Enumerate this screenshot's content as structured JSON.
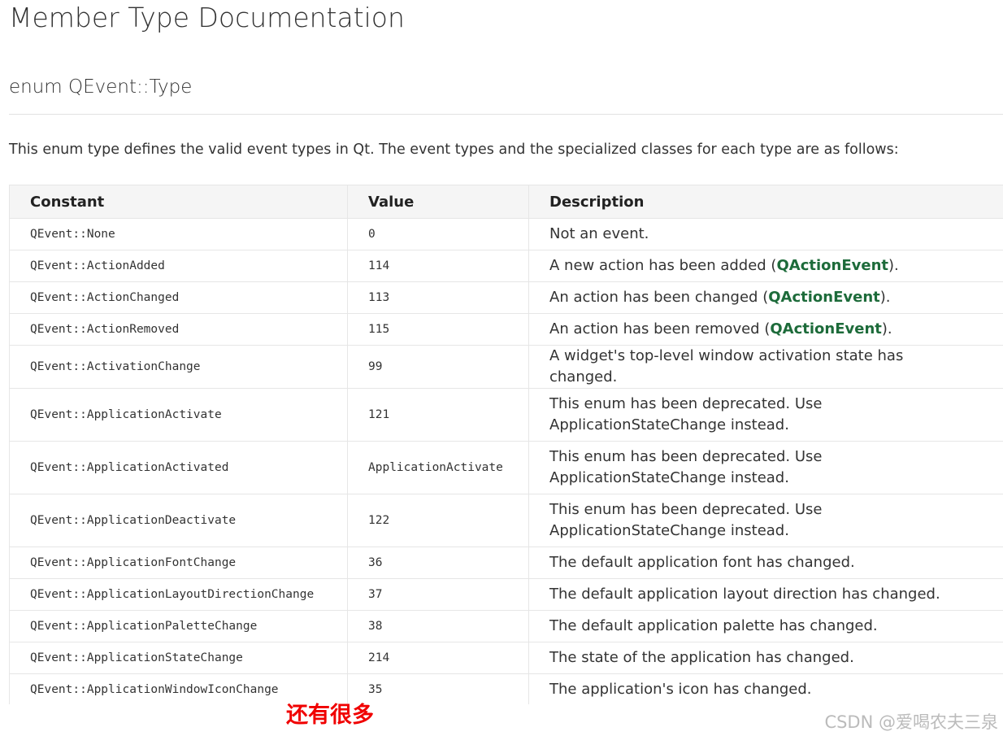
{
  "page": {
    "title": "Member Type Documentation",
    "enum_title": "enum QEvent::Type",
    "intro": "This enum type defines the valid event types in Qt. The event types and the specialized classes for each type are as follows:"
  },
  "table": {
    "headers": {
      "constant": "Constant",
      "value": "Value",
      "description": "Description"
    },
    "rows": [
      {
        "constant": "QEvent::None",
        "value": "0",
        "desc": "Not an event."
      },
      {
        "constant": "QEvent::ActionAdded",
        "value": "114",
        "desc_pre": "A new action has been added (",
        "link": "QActionEvent",
        "desc_post": ")."
      },
      {
        "constant": "QEvent::ActionChanged",
        "value": "113",
        "desc_pre": "An action has been changed (",
        "link": "QActionEvent",
        "desc_post": ")."
      },
      {
        "constant": "QEvent::ActionRemoved",
        "value": "115",
        "desc_pre": "An action has been removed (",
        "link": "QActionEvent",
        "desc_post": ")."
      },
      {
        "constant": "QEvent::ActivationChange",
        "value": "99",
        "desc": "A widget's top-level window activation state has changed."
      },
      {
        "constant": "QEvent::ApplicationActivate",
        "value": "121",
        "desc": "This enum has been deprecated. Use ApplicationStateChange instead."
      },
      {
        "constant": "QEvent::ApplicationActivated",
        "value": "ApplicationActivate",
        "desc": "This enum has been deprecated. Use ApplicationStateChange instead."
      },
      {
        "constant": "QEvent::ApplicationDeactivate",
        "value": "122",
        "desc": "This enum has been deprecated. Use ApplicationStateChange instead."
      },
      {
        "constant": "QEvent::ApplicationFontChange",
        "value": "36",
        "desc": "The default application font has changed."
      },
      {
        "constant": "QEvent::ApplicationLayoutDirectionChange",
        "value": "37",
        "desc": "The default application layout direction has changed."
      },
      {
        "constant": "QEvent::ApplicationPaletteChange",
        "value": "38",
        "desc": "The default application palette has changed."
      },
      {
        "constant": "QEvent::ApplicationStateChange",
        "value": "214",
        "desc": "The state of the application has changed."
      },
      {
        "constant": "QEvent::ApplicationWindowIconChange",
        "value": "35",
        "desc": "The application's icon has changed."
      }
    ]
  },
  "annotation": {
    "more_note": "还有很多"
  },
  "watermark": {
    "text": "CSDN @爱喝农夫三泉"
  },
  "colors": {
    "link": "#1d6b3a",
    "note": "#f00000"
  }
}
